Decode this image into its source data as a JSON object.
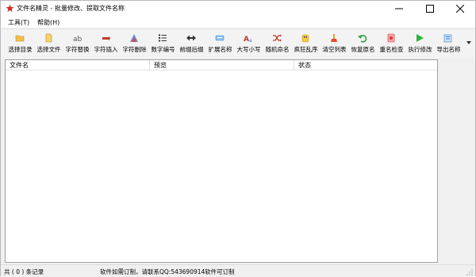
{
  "window": {
    "title": "文件名精灵 - 批量修改、提取文件名称"
  },
  "menu": [
    {
      "label": "工具(T)"
    },
    {
      "label": "帮助(H)"
    }
  ],
  "toolbar": [
    {
      "label": "选择目录",
      "icon": "folder-open-icon",
      "color": "#e8b13a"
    },
    {
      "label": "选择文件",
      "icon": "file-icon",
      "color": "#e8b13a"
    },
    {
      "label": "字符替换",
      "icon": "text-replace-icon",
      "color": "#555555"
    },
    {
      "label": "字符插入",
      "icon": "text-insert-icon",
      "color": "#c0392b"
    },
    {
      "label": "字符删除",
      "icon": "text-delete-icon",
      "color": "#3a6fd8"
    },
    {
      "label": "数字编号",
      "icon": "numbered-list-icon",
      "color": "#333333"
    },
    {
      "label": "前缀后缀",
      "icon": "arrows-left-right-icon",
      "color": "#333333"
    },
    {
      "label": "扩展名称",
      "icon": "extension-icon",
      "color": "#3a8fd8"
    },
    {
      "label": "大写小写",
      "icon": "case-icon",
      "color": "#c0392b"
    },
    {
      "label": "随机命名",
      "icon": "shuffle-icon",
      "color": "#c0392b"
    },
    {
      "label": "疯狂乱序",
      "icon": "shuffle-crazy-icon",
      "color": "#e0a800"
    },
    {
      "label": "清空列表",
      "icon": "clear-list-icon",
      "color": "#e84a2a"
    },
    {
      "label": "恢复原名",
      "icon": "undo-icon",
      "color": "#2a9d3a"
    },
    {
      "label": "重名检查",
      "icon": "duplicate-check-icon",
      "color": "#d83a3a"
    },
    {
      "label": "执行修改",
      "icon": "play-icon",
      "color": "#2bb33a"
    },
    {
      "label": "导出名称",
      "icon": "export-icon",
      "color": "#3a7fd8"
    }
  ],
  "grid": {
    "columns": [
      "文件名",
      "预览",
      "状态"
    ],
    "rows": []
  },
  "status": {
    "count": "共 ( 0 ) 条记录",
    "custom": "软件如需订制，请联系QQ:543690914",
    "customizable": "软件可订制"
  },
  "colors": {
    "titlebar": "#ffffff",
    "chrome": "#f0f0f0",
    "app_icon": "#d22828"
  }
}
